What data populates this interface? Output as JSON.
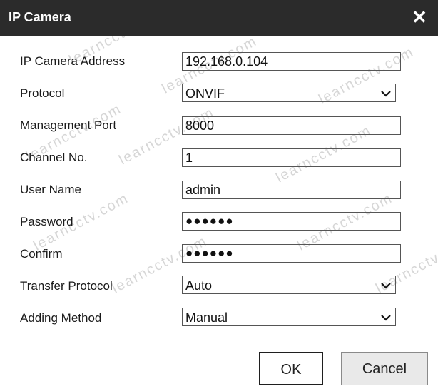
{
  "dialog": {
    "title": "IP Camera",
    "close_glyph": "✕"
  },
  "watermark_text": "learncctv.com",
  "form": {
    "ip_address_label": "IP Camera Address",
    "ip_address_value": "192.168.0.104",
    "protocol_label": "Protocol",
    "protocol_value": "ONVIF",
    "management_port_label": "Management Port",
    "management_port_value": "8000",
    "channel_label": "Channel No.",
    "channel_value": "1",
    "username_label": "User Name",
    "username_value": "admin",
    "password_label": "Password",
    "password_value": "●●●●●●",
    "confirm_label": "Confirm",
    "confirm_value": "●●●●●●",
    "transfer_protocol_label": "Transfer Protocol",
    "transfer_protocol_value": "Auto",
    "adding_method_label": "Adding Method",
    "adding_method_value": "Manual"
  },
  "buttons": {
    "ok_label": "OK",
    "cancel_label": "Cancel"
  },
  "icons": {
    "dropdown": "chevron-down-icon",
    "close": "close-icon"
  }
}
